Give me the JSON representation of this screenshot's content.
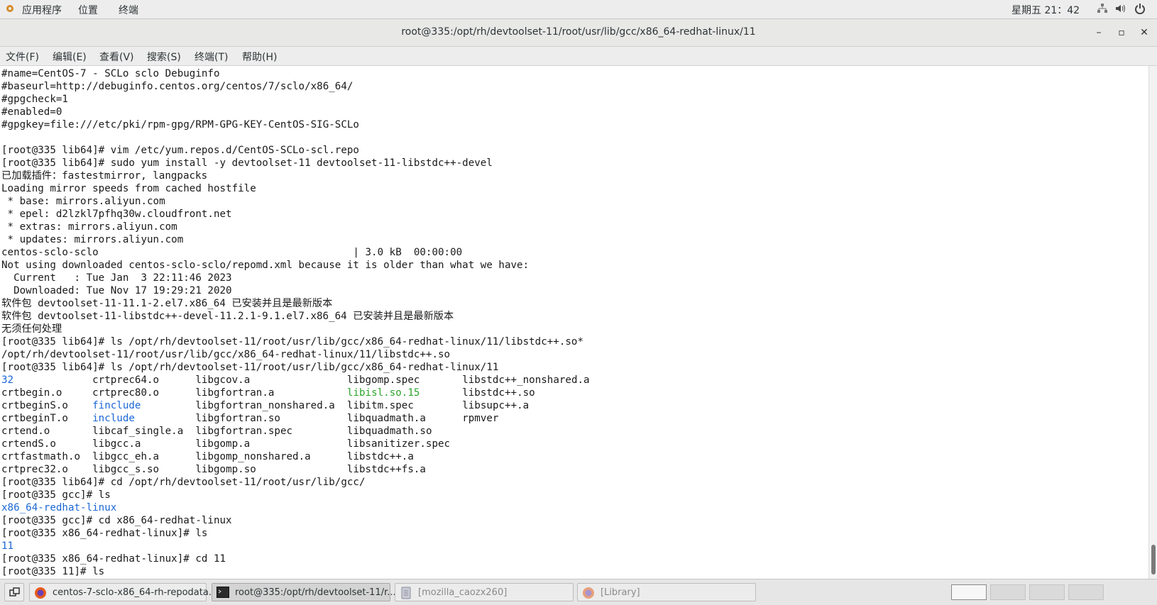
{
  "top_panel": {
    "apps_label": "应用程序",
    "places_label": "位置",
    "terminal_label": "终端",
    "clock": "星期五 21：42",
    "icons": [
      "network-icon",
      "volume-icon",
      "power-icon"
    ]
  },
  "window": {
    "title": "root@335:/opt/rh/devtoolset-11/root/usr/lib/gcc/x86_64-redhat-linux/11",
    "minimize": "–",
    "maximize": "▫",
    "close": "✕"
  },
  "menubar": {
    "file": "文件(F)",
    "edit": "编辑(E)",
    "view": "查看(V)",
    "search": "搜索(S)",
    "terminal": "终端(T)",
    "help": "帮助(H)"
  },
  "terminal": {
    "lines": [
      "#name=CentOS-7 - SCLo sclo Debuginfo",
      "#baseurl=http://debuginfo.centos.org/centos/7/sclo/x86_64/",
      "#gpgcheck=1",
      "#enabled=0",
      "#gpgkey=file:///etc/pki/rpm-gpg/RPM-GPG-KEY-CentOS-SIG-SCLo",
      "",
      "[root@335 lib64]# vim /etc/yum.repos.d/CentOS-SCLo-scl.repo",
      "[root@335 lib64]# sudo yum install -y devtoolset-11 devtoolset-11-libstdc++-devel",
      "已加载插件：fastestmirror, langpacks",
      "Loading mirror speeds from cached hostfile",
      " * base: mirrors.aliyun.com",
      " * epel: d2lzkl7pfhq30w.cloudfront.net",
      " * extras: mirrors.aliyun.com",
      " * updates: mirrors.aliyun.com",
      "centos-sclo-sclo                                          | 3.0 kB  00:00:00",
      "Not using downloaded centos-sclo-sclo/repomd.xml because it is older than what we have:",
      "  Current   : Tue Jan  3 22:11:46 2023",
      "  Downloaded: Tue Nov 17 19:29:21 2020",
      "软件包 devtoolset-11-11.1-2.el7.x86_64 已安装并且是最新版本",
      "软件包 devtoolset-11-libstdc++-devel-11.2.1-9.1.el7.x86_64 已安装并且是最新版本",
      "无须任何处理",
      "[root@335 lib64]# ls /opt/rh/devtoolset-11/root/usr/lib/gcc/x86_64-redhat-linux/11/libstdc++.so*",
      "/opt/rh/devtoolset-11/root/usr/lib/gcc/x86_64-redhat-linux/11/libstdc++.so",
      "[root@335 lib64]# ls /opt/rh/devtoolset-11/root/usr/lib/gcc/x86_64-redhat-linux/11"
    ],
    "listing": [
      [
        "32",
        "crtprec64.o",
        "libgcov.a",
        "libgomp.spec",
        "libstdc++_nonshared.a"
      ],
      [
        "crtbegin.o",
        "crtprec80.o",
        "libgfortran.a",
        "libisl.so.15",
        "libstdc++.so"
      ],
      [
        "crtbeginS.o",
        "finclude",
        "libgfortran_nonshared.a",
        "libitm.spec",
        "libsupc++.a"
      ],
      [
        "crtbeginT.o",
        "include",
        "libgfortran.so",
        "libquadmath.a",
        "rpmver"
      ],
      [
        "crtend.o",
        "libcaf_single.a",
        "libgfortran.spec",
        "libquadmath.so",
        ""
      ],
      [
        "crtendS.o",
        "libgcc.a",
        "libgomp.a",
        "libsanitizer.spec",
        ""
      ],
      [
        "crtfastmath.o",
        "libgcc_eh.a",
        "libgomp_nonshared.a",
        "libstdc++.a",
        ""
      ],
      [
        "crtprec32.o",
        "libgcc_s.so",
        "libgomp.so",
        "libstdc++fs.a",
        ""
      ]
    ],
    "lines_after": [
      "[root@335 lib64]# cd /opt/rh/devtoolset-11/root/usr/lib/gcc/",
      "[root@335 gcc]# ls",
      "x86_64-redhat-linux",
      "[root@335 gcc]# cd x86_64-redhat-linux",
      "[root@335 x86_64-redhat-linux]# ls",
      "11",
      "[root@335 x86_64-redhat-linux]# cd 11",
      "[root@335 11]# ls"
    ],
    "dir_color": "#1c68d6",
    "link_color": "#2ca52c"
  },
  "taskbar": {
    "show_desktop_icon": "show-desktop-icon",
    "tasks": [
      {
        "label": "centos-7-sclo-x86_64-rh-repodata...",
        "icon": "firefox-icon"
      },
      {
        "label": "root@335:/opt/rh/devtoolset-11/r...",
        "icon": "terminal-icon"
      },
      {
        "label": "[mozilla_caozx260]",
        "icon": "file-manager-icon"
      },
      {
        "label": "[Library]",
        "icon": "firefox-icon"
      }
    ]
  }
}
